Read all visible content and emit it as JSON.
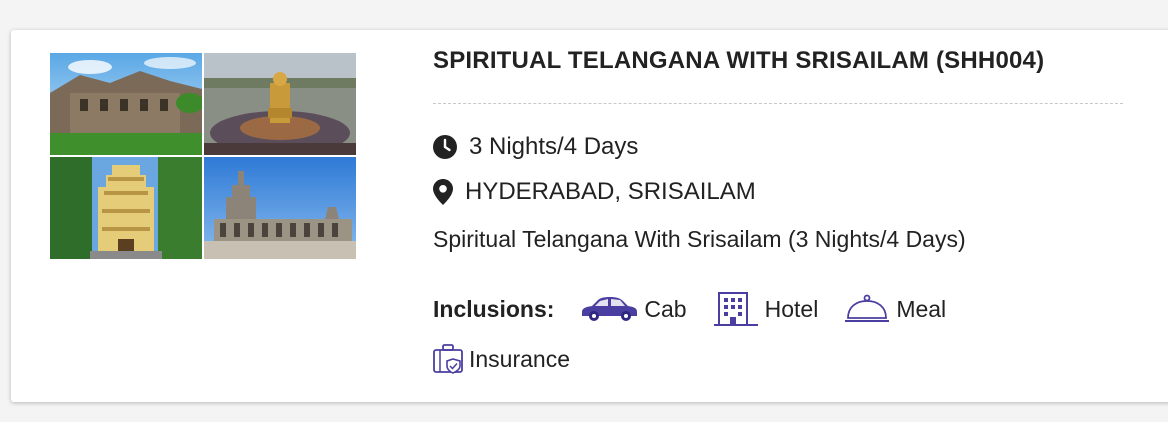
{
  "package": {
    "title": "SPIRITUAL TELANGANA WITH SRISAILAM (SHH004)",
    "duration": "3 Nights/4 Days",
    "location": "HYDERABAD, SRISAILAM",
    "description": "Spiritual Telangana With Srisailam (3 Nights/4 Days)"
  },
  "inclusions": {
    "label": "Inclusions:",
    "items": [
      {
        "label": "Cab",
        "icon": "cab-icon"
      },
      {
        "label": "Hotel",
        "icon": "hotel-icon"
      },
      {
        "label": "Meal",
        "icon": "meal-icon"
      },
      {
        "label": "Insurance",
        "icon": "insurance-icon"
      }
    ]
  },
  "colors": {
    "accent_icon": "#4a3fa0",
    "text": "#222222"
  }
}
